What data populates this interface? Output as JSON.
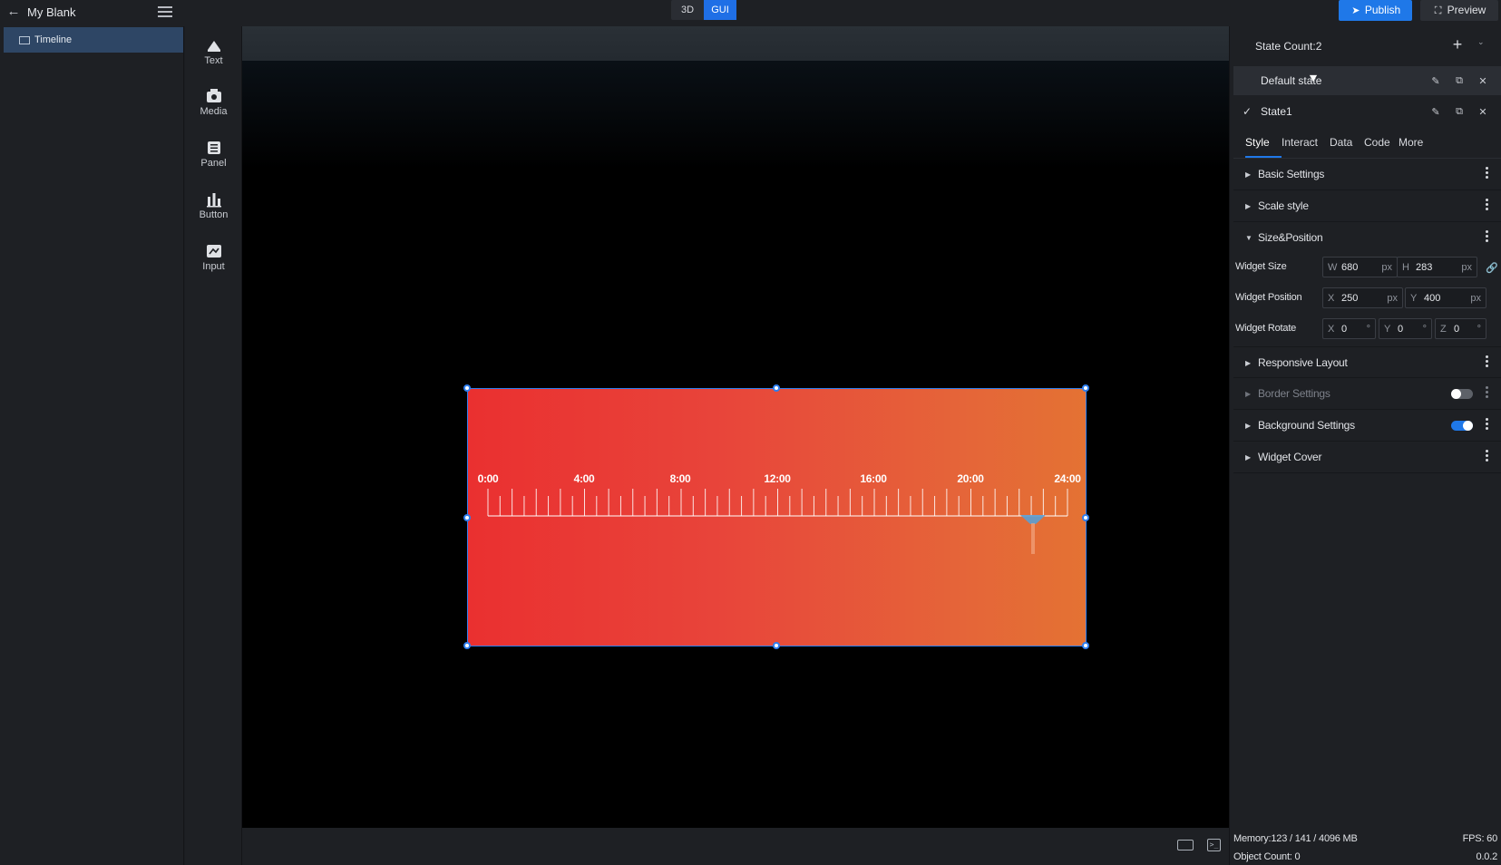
{
  "project": {
    "title": "My Blank"
  },
  "mode_toggle": {
    "options": [
      "3D",
      "GUI"
    ],
    "active": "GUI"
  },
  "header": {
    "publish_label": "Publish",
    "preview_label": "Preview"
  },
  "tree": {
    "items": [
      {
        "label": "Timeline",
        "selected": true
      }
    ]
  },
  "toolbar": {
    "items": [
      {
        "label": "Text",
        "icon": "text-icon"
      },
      {
        "label": "Media",
        "icon": "media-icon"
      },
      {
        "label": "Panel",
        "icon": "panel-icon"
      },
      {
        "label": "Button",
        "icon": "button-icon"
      },
      {
        "label": "Input",
        "icon": "input-icon"
      }
    ]
  },
  "widget": {
    "type": "Timeline",
    "time_labels": [
      "0:00",
      "4:00",
      "8:00",
      "12:00",
      "16:00",
      "20:00",
      "24:00"
    ],
    "gradient_colors": [
      "#ea3030",
      "#e47233"
    ],
    "pointer_color": "#5a9fd4"
  },
  "states": {
    "count_label": "State Count:2",
    "items": [
      {
        "name": "Default state",
        "checked": false
      },
      {
        "name": "State1",
        "checked": true
      }
    ]
  },
  "tabs": {
    "items": [
      "Style",
      "Interact",
      "Data",
      "Code",
      "More"
    ],
    "active": "Style"
  },
  "sections": {
    "basic": "Basic Settings",
    "scale": "Scale style",
    "size_position": "Size&Position",
    "responsive": "Responsive Layout",
    "border": "Border Settings",
    "background": "Background Settings",
    "cover": "Widget Cover"
  },
  "props": {
    "size": {
      "label": "Widget Size",
      "w_axis": "W",
      "w": "680",
      "w_unit": "px",
      "h_axis": "H",
      "h": "283",
      "h_unit": "px"
    },
    "position": {
      "label": "Widget Position",
      "x_axis": "X",
      "x": "250",
      "x_unit": "px",
      "y_axis": "Y",
      "y": "400",
      "y_unit": "px"
    },
    "rotate": {
      "label": "Widget Rotate",
      "x_axis": "X",
      "x": "0",
      "y_axis": "Y",
      "y": "0",
      "z_axis": "Z",
      "z": "0",
      "unit": "°"
    }
  },
  "toggles": {
    "border_enabled": false,
    "background_enabled": true
  },
  "status": {
    "memory": "Memory:123 / 141 / 4096 MB",
    "fps": "FPS: 60",
    "objects": "Object Count: 0",
    "version": "0.0.2"
  },
  "colors": {
    "accent": "#1f78e8",
    "selection": "#2e4665",
    "panel_bg": "#1e2024"
  }
}
